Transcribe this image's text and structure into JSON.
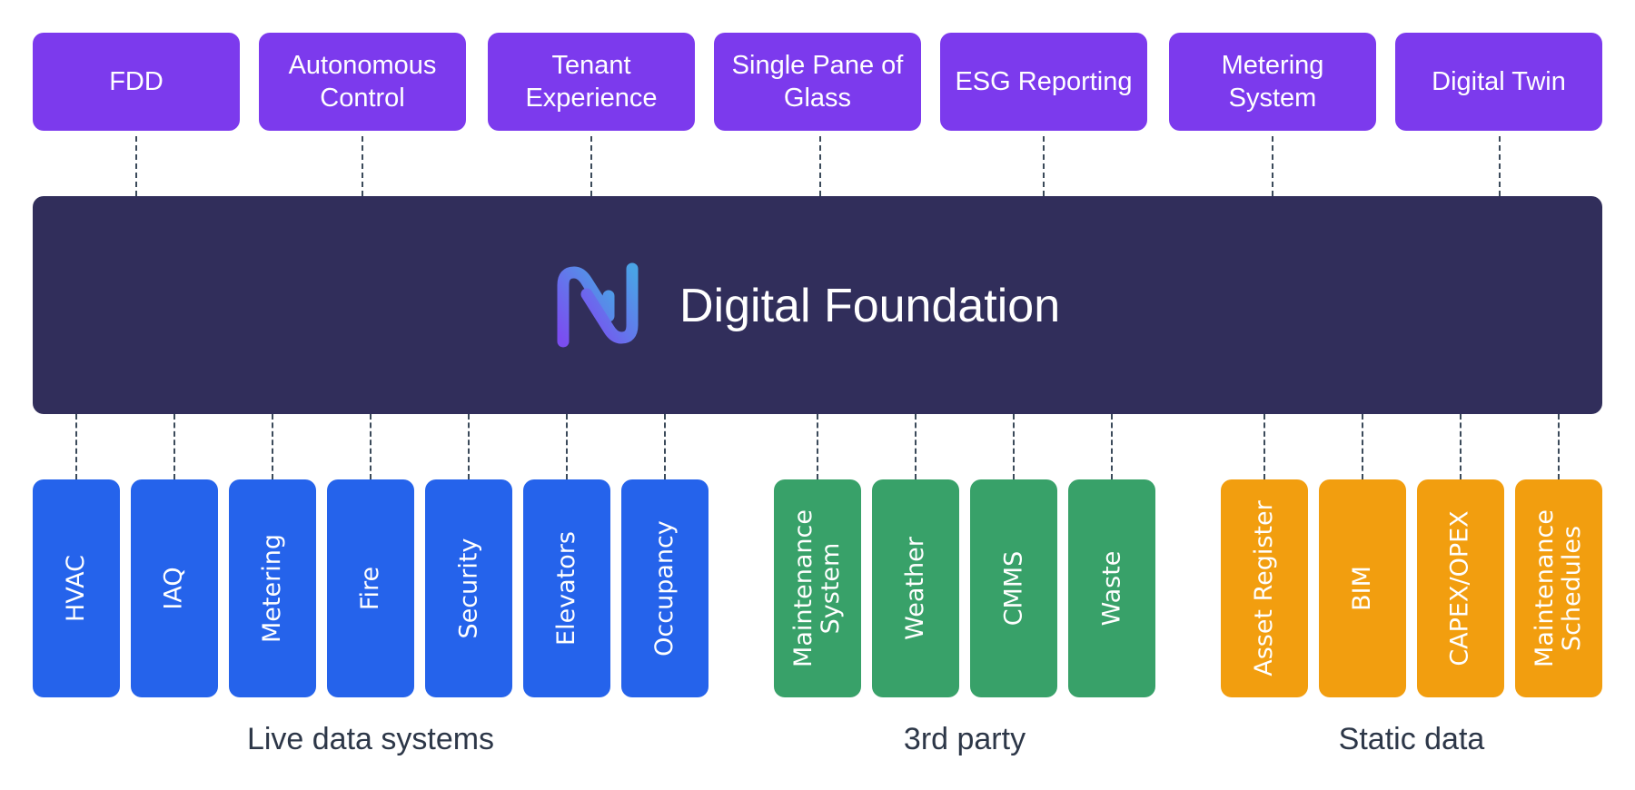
{
  "colors": {
    "application": "#7c3aed",
    "foundation": "#312e5b",
    "live": "#2563eb",
    "third_party": "#38a169",
    "static": "#f29e0f",
    "connector": "#3b4a5a",
    "group_label": "#2d3748"
  },
  "applications": [
    {
      "label": "FDD"
    },
    {
      "label": "Autonomous Control"
    },
    {
      "label": "Tenant Experience"
    },
    {
      "label": "Single Pane of Glass"
    },
    {
      "label": "ESG Reporting"
    },
    {
      "label": "Metering System"
    },
    {
      "label": "Digital Twin"
    }
  ],
  "foundation": {
    "title": "Digital Foundation",
    "logo_icon": "n-logo-icon"
  },
  "groups": [
    {
      "label": "Live data systems",
      "items": [
        "HVAC",
        "IAQ",
        "Metering",
        "Fire",
        "Security",
        "Elevators",
        "Occupancy"
      ]
    },
    {
      "label": "3rd party",
      "items": [
        "Maintenance System",
        "Weather",
        "CMMS",
        "Waste"
      ]
    },
    {
      "label": "Static data",
      "items": [
        "Asset Register",
        "BIM",
        "CAPEX/OPEX",
        "Maintenance Schedules"
      ]
    }
  ]
}
